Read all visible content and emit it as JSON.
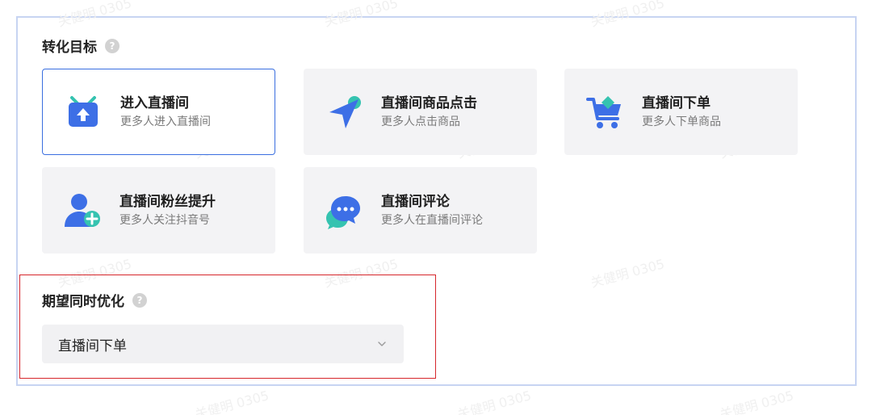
{
  "conversion_goal": {
    "title": "转化目标",
    "help": "?",
    "options": [
      {
        "title": "进入直播间",
        "subtitle": "更多人进入直播间",
        "icon": "tv-enter-icon",
        "selected": true
      },
      {
        "title": "直播间商品点击",
        "subtitle": "更多人点击商品",
        "icon": "cursor-click-icon",
        "selected": false
      },
      {
        "title": "直播间下单",
        "subtitle": "更多人下单商品",
        "icon": "shopping-cart-icon",
        "selected": false
      },
      {
        "title": "直播间粉丝提升",
        "subtitle": "更多人关注抖音号",
        "icon": "add-follower-icon",
        "selected": false
      },
      {
        "title": "直播间评论",
        "subtitle": "更多人在直播间评论",
        "icon": "chat-bubble-icon",
        "selected": false
      }
    ]
  },
  "co_optimize": {
    "title": "期望同时优化",
    "help": "?",
    "selected_value": "直播间下单"
  },
  "watermark": "关健明 0305",
  "colors": {
    "accent": "#3a6fe0",
    "highlight_border": "#d6262b",
    "card_bg": "#f3f3f5",
    "icon_blue": "#3d6fe6",
    "icon_teal": "#35c3b0"
  }
}
